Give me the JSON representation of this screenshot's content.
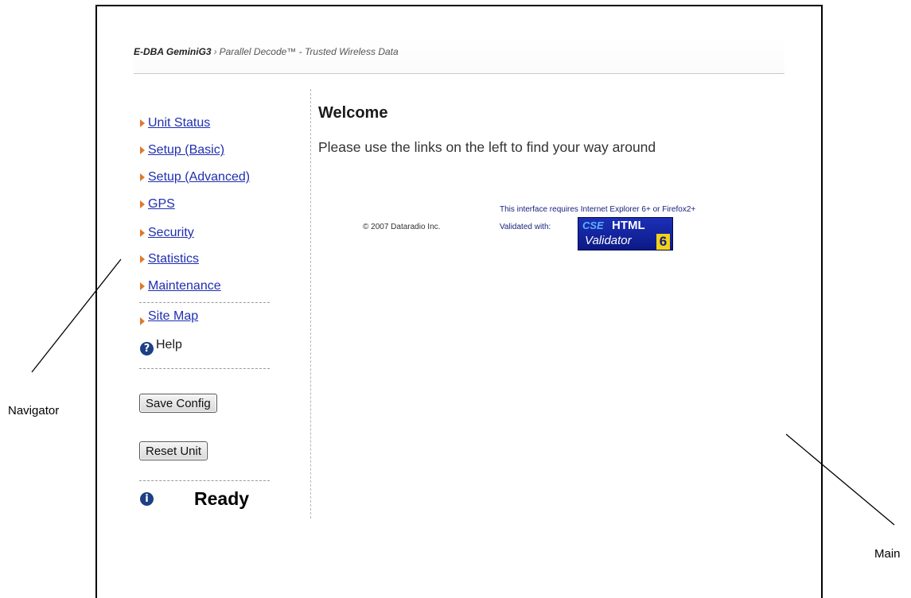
{
  "header": {
    "product": "E-DBA GeminiG3",
    "separator": "›",
    "tagline": "Parallel Decode™ - Trusted Wireless Data"
  },
  "nav": {
    "items": [
      {
        "label": "Unit Status"
      },
      {
        "label": "Setup (Basic)"
      },
      {
        "label": "Setup (Advanced)"
      },
      {
        "label": "GPS"
      },
      {
        "label": "Security"
      },
      {
        "label": "Statistics"
      },
      {
        "label": "Maintenance"
      }
    ],
    "site_map": " Site Map",
    "help": "Help",
    "save_button": "Save Config",
    "reset_button": "Reset Unit",
    "status": "Ready"
  },
  "main": {
    "title": "Welcome",
    "message": "Please use the links on the left to find your way around",
    "copyright": "© 2007 Dataradio Inc.",
    "requirement": "This interface requires Internet Explorer 6+ or Firefox2+",
    "validated_with": "Validated with:",
    "badge": {
      "brand": "CSE",
      "title": "HTML",
      "subtitle": "Validator",
      "version": "6"
    }
  },
  "annotations": {
    "navigator": "Navigator",
    "main": "Main"
  },
  "colors": {
    "link": "#1f2fb0",
    "arrow": "#e0792b",
    "icon": "#1d3f86",
    "badge": "#1c2fb7"
  },
  "icons": {
    "nav_arrow": "orange-triangle",
    "help": "help-icon",
    "status": "info-icon"
  }
}
